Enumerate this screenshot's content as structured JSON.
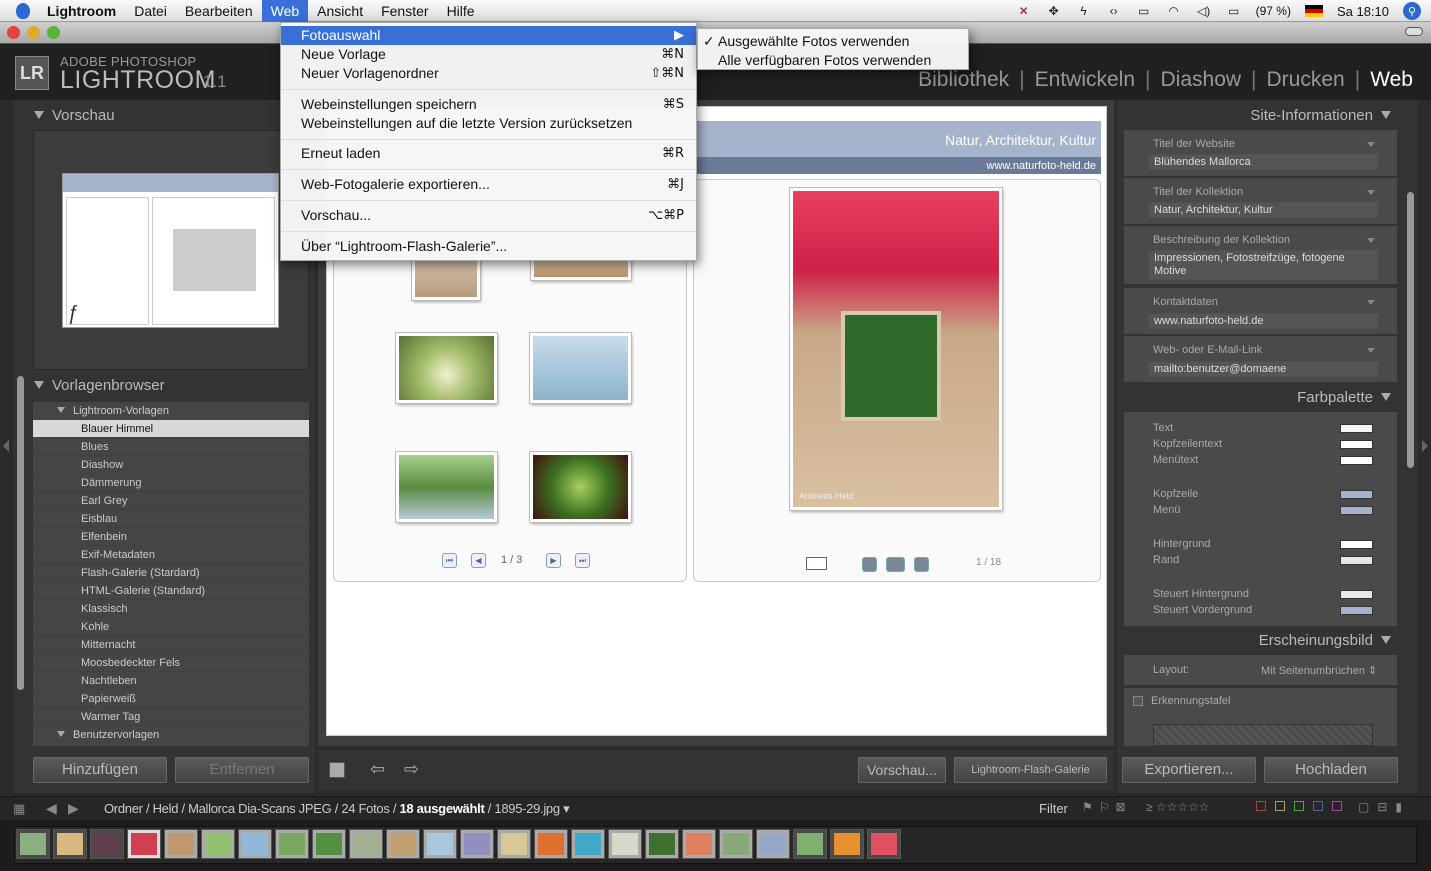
{
  "menubar": {
    "app": "Lightroom",
    "items": [
      "Datei",
      "Bearbeiten",
      "Web",
      "Ansicht",
      "Fenster",
      "Hilfe"
    ],
    "active": "Web",
    "battery": "(97 %)",
    "clock": "Sa 18:10"
  },
  "brand": {
    "logo": "LR",
    "line1": "ADOBE PHOTOSHOP",
    "line2": "LIGHTROOM",
    "version": "1.1"
  },
  "modules": [
    "Bibliothek",
    "Entwickeln",
    "Diashow",
    "Drucken",
    "Web"
  ],
  "current_module": "Web",
  "left": {
    "preview_title": "Vorschau",
    "browser_title": "Vorlagenbrowser",
    "group1": "Lightroom-Vorlagen",
    "templates": [
      "Blauer Himmel",
      "Blues",
      "Diashow",
      "Dämmerung",
      "Earl Grey",
      "Eisblau",
      "Elfenbein",
      "Exif-Metadaten",
      "Flash-Galerie (Stardard)",
      "HTML-Galerie (Standard)",
      "Klassisch",
      "Kohle",
      "Mitternacht",
      "Moosbedeckter Fels",
      "Nachtleben",
      "Papierweiß",
      "Warmer Tag"
    ],
    "selected": "Blauer Himmel",
    "group2": "Benutzervorlagen",
    "add_button": "Hinzufügen",
    "remove_button": "Entfernen"
  },
  "gallery": {
    "heading": "Natur, Architektur, Kultur",
    "site": "www.naturfoto-held.de",
    "page_indicator": "1 / 3",
    "count": "1 / 18",
    "watermark": "Andreas Held"
  },
  "toolbar": {
    "preview_button": "Vorschau...",
    "gallery_type": "Lightroom-Flash-Galerie"
  },
  "right": {
    "site_info_title": "Site-Informationen",
    "fields": [
      {
        "label": "Titel der Website",
        "value": "Blühendes Mallorca"
      },
      {
        "label": "Titel der Kollektion",
        "value": "Natur, Architektur, Kultur"
      },
      {
        "label": "Beschreibung der Kollektion",
        "value": "Impressionen, Fotostreifzüge, fotogene Motive"
      },
      {
        "label": "Kontaktdaten",
        "value": "www.naturfoto-held.de"
      },
      {
        "label": "Web- oder E-Mail-Link",
        "value": "mailto:benutzer@domaene"
      }
    ],
    "palette_title": "Farbpalette",
    "palette": [
      {
        "label": "Text",
        "color": "#f4f4f4"
      },
      {
        "label": "Kopfzeilentext",
        "color": "#ffffff"
      },
      {
        "label": "Menütext",
        "color": "#ffffff"
      },
      {
        "label": "Kopfzeile",
        "color": "#a6b3cc"
      },
      {
        "label": "Menü",
        "color": "#a6b3cc"
      },
      {
        "label": "Hintergrund",
        "color": "#ffffff"
      },
      {
        "label": "Rand",
        "color": "#e4e6ea"
      },
      {
        "label": "Steuert Hintergrund",
        "color": "#e8e8e8"
      },
      {
        "label": "Steuert Vordergrund",
        "color": "#a6b3cc"
      }
    ],
    "appearance_title": "Erscheinungsbild",
    "layout_label": "Layout:",
    "layout_value": "Mit Seitenumbrüchen",
    "identity_label": "Erkennungstafel",
    "export_button": "Exportieren...",
    "upload_button": "Hochladen"
  },
  "filmbar": {
    "path_prefix": "Ordner / Held / Mallorca Dia-Scans JPEG / 24 Fotos / ",
    "selected": "18 ausgewählt",
    "file": " / 1895-29.jpg",
    "filter_label": "Filter"
  },
  "menu": {
    "items": [
      {
        "label": "Fotoauswahl",
        "key": "▶"
      },
      {
        "label": "Neue Vorlage",
        "key": "⌘N"
      },
      {
        "label": "Neuer Vorlagenordner",
        "key": "⇧⌘N"
      },
      {
        "label": "Webeinstellungen speichern",
        "key": "⌘S"
      },
      {
        "label": "Webeinstellungen auf die letzte Version zurücksetzen",
        "key": ""
      },
      {
        "label": "Erneut laden",
        "key": "⌘R"
      },
      {
        "label": "Web-Fotogalerie exportieren...",
        "key": "⌘J"
      },
      {
        "label": "Vorschau...",
        "key": "⌥⌘P"
      },
      {
        "label": "Über “Lightroom-Flash-Galerie”...",
        "key": ""
      }
    ],
    "submenu": [
      "Ausgewählte Fotos verwenden",
      "Alle verfügbaren Fotos verwenden"
    ],
    "check": "✓"
  }
}
